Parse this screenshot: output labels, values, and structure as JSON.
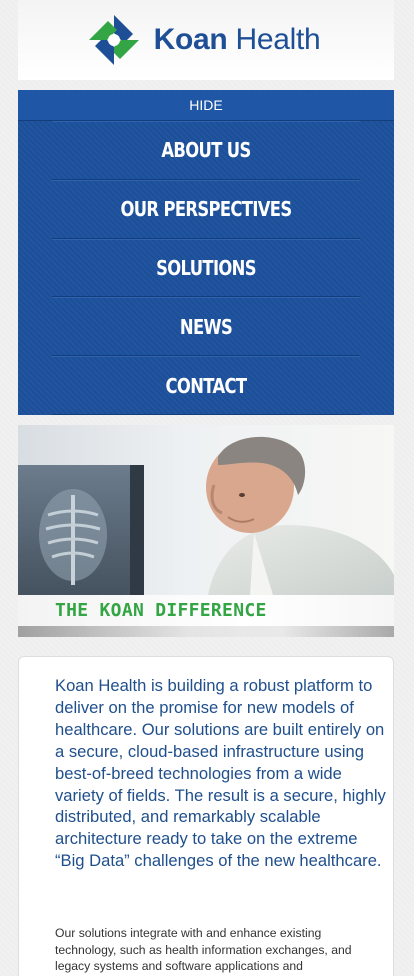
{
  "header": {
    "brand_bold": "Koan",
    "brand_light": " Health",
    "brand_colors": {
      "blue": "#1e4f96",
      "green": "#33a544"
    }
  },
  "nav": {
    "hide_label": "HIDE",
    "items": [
      {
        "label": "ABOUT US"
      },
      {
        "label": "OUR PERSPECTIVES"
      },
      {
        "label": "SOLUTIONS"
      },
      {
        "label": "NEWS"
      },
      {
        "label": "CONTACT"
      }
    ],
    "color": "#1b4f9a"
  },
  "hero": {
    "caption": "THE KOAN DIFFERENCE",
    "caption_color": "#33a544"
  },
  "content": {
    "lead": "Koan Health is building a robust platform to deliver on the promise for new models of healthcare. Our solutions are built entirely on a secure, cloud-based infrastructure using best-of-breed technologies from a wide variety of fields. The result is a secure, highly distributed, and remarkably scalable architecture ready to take on the extreme “Big Data” challenges of the new healthcare.",
    "body": "Our solutions integrate with and enhance existing technology, such as health information exchanges, and legacy systems and software applications and"
  }
}
